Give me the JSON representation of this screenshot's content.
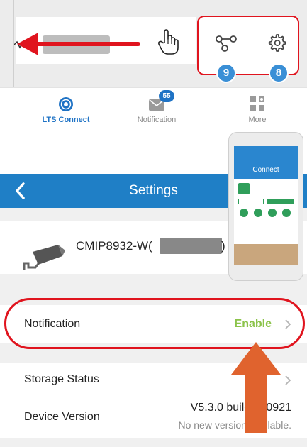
{
  "top": {
    "badge_left": "9",
    "badge_right": "8"
  },
  "tabbar": {
    "items": [
      {
        "label": "LTS Connect",
        "active": true
      },
      {
        "label": "Notification",
        "badge": "55"
      },
      {
        "label": "More"
      }
    ]
  },
  "settings": {
    "title": "Settings",
    "device_name": "CMIP8932-W(",
    "device_close": ")",
    "rows": {
      "notification": {
        "label": "Notification",
        "value": "Enable"
      },
      "storage": {
        "label": "Storage Status"
      },
      "version": {
        "label": "Device Version",
        "value": "V5.3.0 build 170921",
        "note": "No new version available."
      }
    }
  },
  "phone": {
    "title": "Connect"
  },
  "colors": {
    "accent_blue": "#1f7fc6",
    "annotation_red": "#e0141e",
    "enable_green": "#8bc34a",
    "arrow_orange": "#e0632e"
  }
}
